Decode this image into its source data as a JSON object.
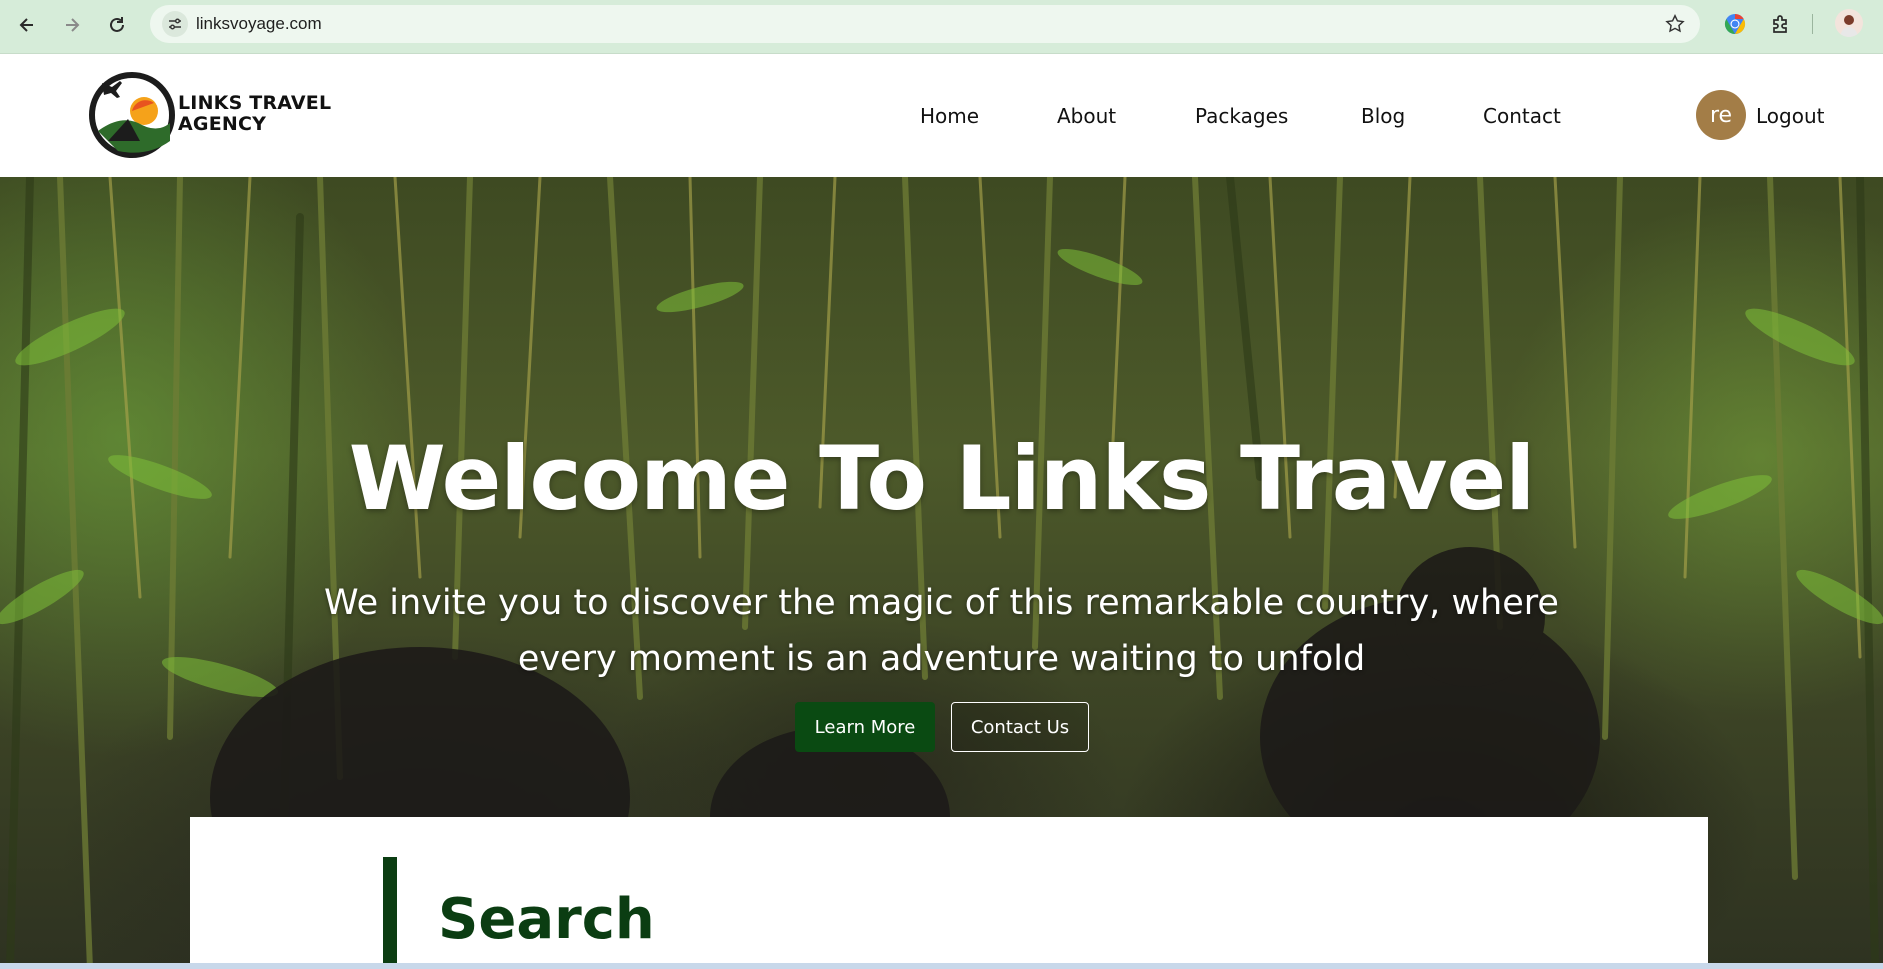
{
  "browser": {
    "url": "linksvoyage.com"
  },
  "header": {
    "logo_text_line1": "LINKS TRAVEL",
    "logo_text_line2": "AGENCY",
    "nav": [
      "Home",
      "About",
      "Packages",
      "Blog",
      "Contact"
    ],
    "avatar_initials": "re",
    "logout_label": "Logout"
  },
  "hero": {
    "title": "Welcome To Links Travel",
    "subtitle": "We invite you to discover the magic of this remarkable country, where every moment is an adventure waiting to unfold",
    "learn_more_label": "Learn More",
    "contact_label": "Contact Us"
  },
  "search": {
    "title": "Search"
  },
  "colors": {
    "brand_green": "#0b3d12",
    "button_green": "#0a4a12",
    "avatar_brown": "#a37d47",
    "chrome_green": "#d6ecd9"
  }
}
